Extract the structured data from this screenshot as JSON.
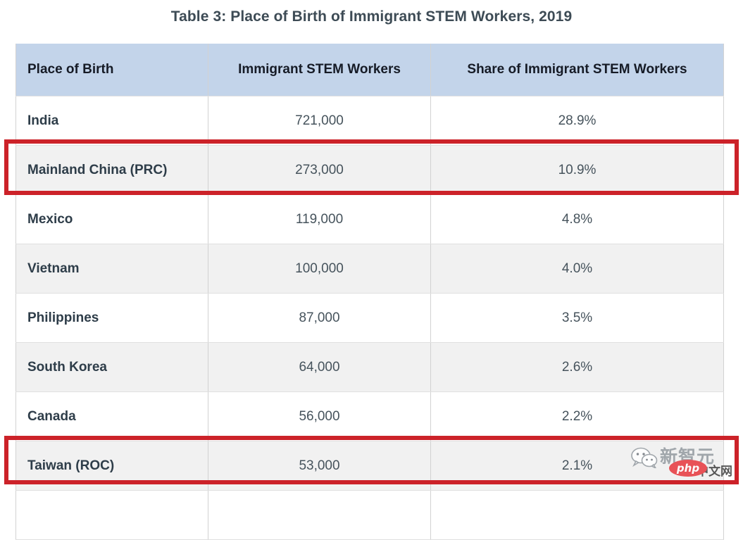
{
  "title": "Table 3: Place of Birth of Immigrant STEM Workers, 2019",
  "table": {
    "columns": [
      "Place of Birth",
      "Immigrant STEM Workers",
      "Share of Immigrant STEM Workers"
    ],
    "rows": [
      {
        "place": "India",
        "workers": "721,000",
        "share": "28.9%",
        "highlighted": false
      },
      {
        "place": "Mainland China (PRC)",
        "workers": "273,000",
        "share": "10.9%",
        "highlighted": true
      },
      {
        "place": "Mexico",
        "workers": "119,000",
        "share": "4.8%",
        "highlighted": false
      },
      {
        "place": "Vietnam",
        "workers": "100,000",
        "share": "4.0%",
        "highlighted": false
      },
      {
        "place": "Philippines",
        "workers": "87,000",
        "share": "3.5%",
        "highlighted": false
      },
      {
        "place": "South Korea",
        "workers": "64,000",
        "share": "2.6%",
        "highlighted": false
      },
      {
        "place": "Canada",
        "workers": "56,000",
        "share": "2.2%",
        "highlighted": false
      },
      {
        "place": "Taiwan (ROC)",
        "workers": "53,000",
        "share": "2.1%",
        "highlighted": true
      }
    ]
  },
  "annotations": {
    "highlight_color": "#cc2229",
    "header_background": "#c3d4ea",
    "alt_row_background": "#f1f1f1"
  },
  "watermark": {
    "icon": "wechat-icon",
    "brand": "新智元",
    "badge": "php",
    "suffix": "中文网"
  },
  "chart_data": {
    "type": "table",
    "title": "Table 3: Place of Birth of Immigrant STEM Workers, 2019",
    "columns": [
      "Place of Birth",
      "Immigrant STEM Workers",
      "Share of Immigrant STEM Workers"
    ],
    "categories": [
      "India",
      "Mainland China (PRC)",
      "Mexico",
      "Vietnam",
      "Philippines",
      "South Korea",
      "Canada",
      "Taiwan (ROC)"
    ],
    "series": [
      {
        "name": "Immigrant STEM Workers",
        "values": [
          721000,
          273000,
          119000,
          100000,
          87000,
          64000,
          56000,
          53000
        ]
      },
      {
        "name": "Share of Immigrant STEM Workers",
        "values": [
          28.9,
          10.9,
          4.8,
          4.0,
          3.5,
          2.6,
          2.2,
          2.1
        ]
      }
    ],
    "xlabel": "Place of Birth",
    "ylabel": "",
    "highlighted_categories": [
      "Mainland China (PRC)",
      "Taiwan (ROC)"
    ]
  }
}
